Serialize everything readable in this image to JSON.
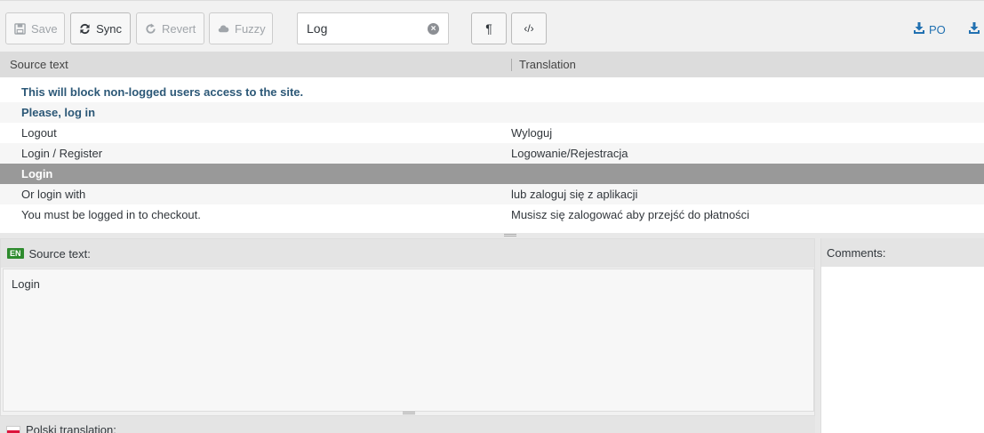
{
  "toolbar": {
    "save_label": "Save",
    "sync_label": "Sync",
    "revert_label": "Revert",
    "fuzzy_label": "Fuzzy",
    "search_value": "Log",
    "pilcrow_glyph": "¶",
    "code_glyph": "‹/›",
    "po_label": "PO"
  },
  "grid": {
    "columns": [
      "Source text",
      "Translation"
    ],
    "rows": [
      {
        "source": "This will block non-logged users access to the site.",
        "translation": "",
        "state": "untranslated"
      },
      {
        "source": "Please, log in",
        "translation": "",
        "state": "untranslated"
      },
      {
        "source": "Logout",
        "translation": "Wyloguj",
        "state": "translated"
      },
      {
        "source": "Login / Register",
        "translation": "Logowanie/Rejestracja",
        "state": "translated"
      },
      {
        "source": "Login",
        "translation": "",
        "state": "selected"
      },
      {
        "source": "Or login with",
        "translation": "lub zaloguj się z aplikacji",
        "state": "translated"
      },
      {
        "source": "You must be logged in to checkout.",
        "translation": "Musisz się zalogować aby przejść do płatności",
        "state": "translated"
      }
    ]
  },
  "source_panel": {
    "lang_code": "EN",
    "heading": "Source text:",
    "text": "Login"
  },
  "comments_panel": {
    "heading": "Comments:"
  },
  "translation_panel": {
    "heading": "Polski translation:"
  },
  "colors": {
    "untranslated_text": "#2c5877",
    "selected_row": "#999999",
    "link": "#2271b1",
    "lang_badge": "#2e8b2e"
  }
}
